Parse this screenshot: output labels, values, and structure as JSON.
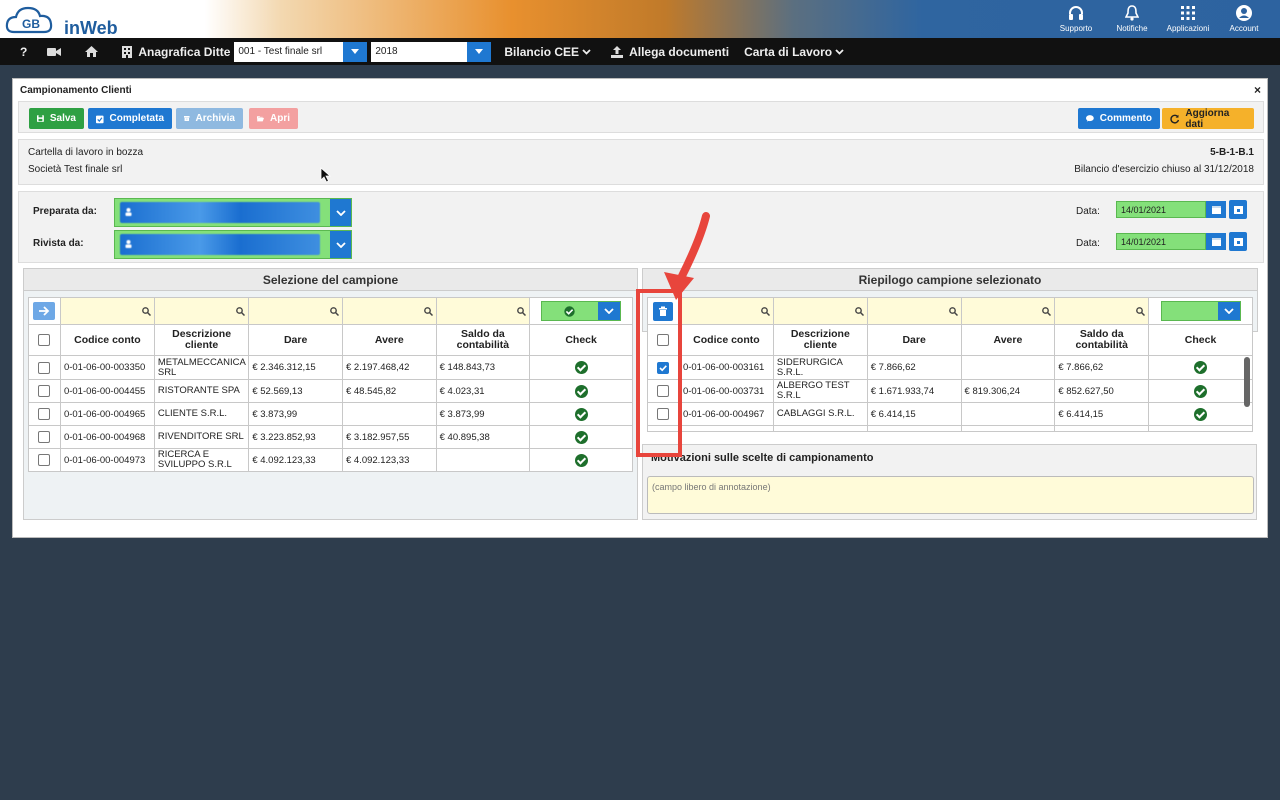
{
  "header": {
    "logo_text": "inWeb",
    "logo_letters": "GB",
    "icons": [
      {
        "name": "headset-icon",
        "label": "Supporto"
      },
      {
        "name": "bell-icon",
        "label": "Notifiche"
      },
      {
        "name": "grid-icon",
        "label": "Applicazioni"
      },
      {
        "name": "account-icon",
        "label": "Account"
      }
    ]
  },
  "navbar": {
    "help": "?",
    "company_label": "Anagrafica Ditte",
    "company_value": "001 - Test finale srl",
    "year_value": "2018",
    "bilancio": "Bilancio CEE",
    "allega": "Allega documenti",
    "carta": "Carta di Lavoro"
  },
  "panel": {
    "title": "Campionamento Clienti",
    "close": "×",
    "buttons": {
      "salva": "Salva",
      "completata": "Completata",
      "archivia": "Archivia",
      "apri": "Apri",
      "commento": "Commento",
      "aggiorna": "Aggiorna dati"
    },
    "info": {
      "stato": "Cartella di lavoro in bozza",
      "societa": "Società Test finale srl",
      "codice": "5-B-1-B.1",
      "bilancio": "Bilancio d'esercizio chiuso al 31/12/2018"
    },
    "form": {
      "preparata_label": "Preparata da:",
      "rivista_label": "Rivista da:",
      "data_label": "Data:",
      "data_preparata": "14/01/2021",
      "data_rivista": "14/01/2021"
    }
  },
  "selezione": {
    "title": "Selezione del campione",
    "columns": [
      "Codice conto",
      "Descrizione cliente",
      "Dare",
      "Avere",
      "Saldo da contabilità",
      "Check"
    ],
    "rows": [
      {
        "codice": "0-01-06-00-003350",
        "descr": "METALMECCANICA SRL",
        "dare": "€ 2.346.312,15",
        "avere": "€ 2.197.468,42",
        "saldo": "€ 148.843,73"
      },
      {
        "codice": "0-01-06-00-004455",
        "descr": "RISTORANTE SPA",
        "dare": "€ 52.569,13",
        "avere": "€ 48.545,82",
        "saldo": "€ 4.023,31"
      },
      {
        "codice": "0-01-06-00-004965",
        "descr": "CLIENTE S.R.L.",
        "dare": "€ 3.873,99",
        "avere": "",
        "saldo": "€ 3.873,99"
      },
      {
        "codice": "0-01-06-00-004968",
        "descr": "RIVENDITORE SRL",
        "dare": "€ 3.223.852,93",
        "avere": "€ 3.182.957,55",
        "saldo": "€ 40.895,38"
      },
      {
        "codice": "0-01-06-00-004973",
        "descr": "RICERCA E SVILUPPO S.R.L",
        "dare": "€ 4.092.123,33",
        "avere": "€ 4.092.123,33",
        "saldo": ""
      }
    ]
  },
  "riepilogo": {
    "title": "Riepilogo campione selezionato",
    "columns": [
      "Codice conto",
      "Descrizione cliente",
      "Dare",
      "Avere",
      "Saldo da contabilità",
      "Check"
    ],
    "rows": [
      {
        "codice": "0-01-06-00-003161",
        "descr": "SIDERURGICA S.R.L.",
        "dare": "€ 7.866,62",
        "avere": "",
        "saldo": "€ 7.866,62",
        "checked": true
      },
      {
        "codice": "0-01-06-00-003731",
        "descr": "ALBERGO TEST S.R.L",
        "dare": "€ 1.671.933,74",
        "avere": "€ 819.306,24",
        "saldo": "€ 852.627,50",
        "checked": false
      },
      {
        "codice": "0-01-06-00-004967",
        "descr": "CABLAGGI S.R.L.",
        "dare": "€ 6.414,15",
        "avere": "",
        "saldo": "€ 6.414,15",
        "checked": false
      }
    ]
  },
  "motivazioni": {
    "title": "Motivazioni sulle scelte di campionamento",
    "placeholder": "(campo libero di annotazione)"
  },
  "colors": {
    "primary": "#1f78d1",
    "success": "#2ea043",
    "warning": "#f5b12a",
    "highlight": "#e8453c",
    "field_green": "#84e07a",
    "filter_yellow": "#fffbd9"
  }
}
